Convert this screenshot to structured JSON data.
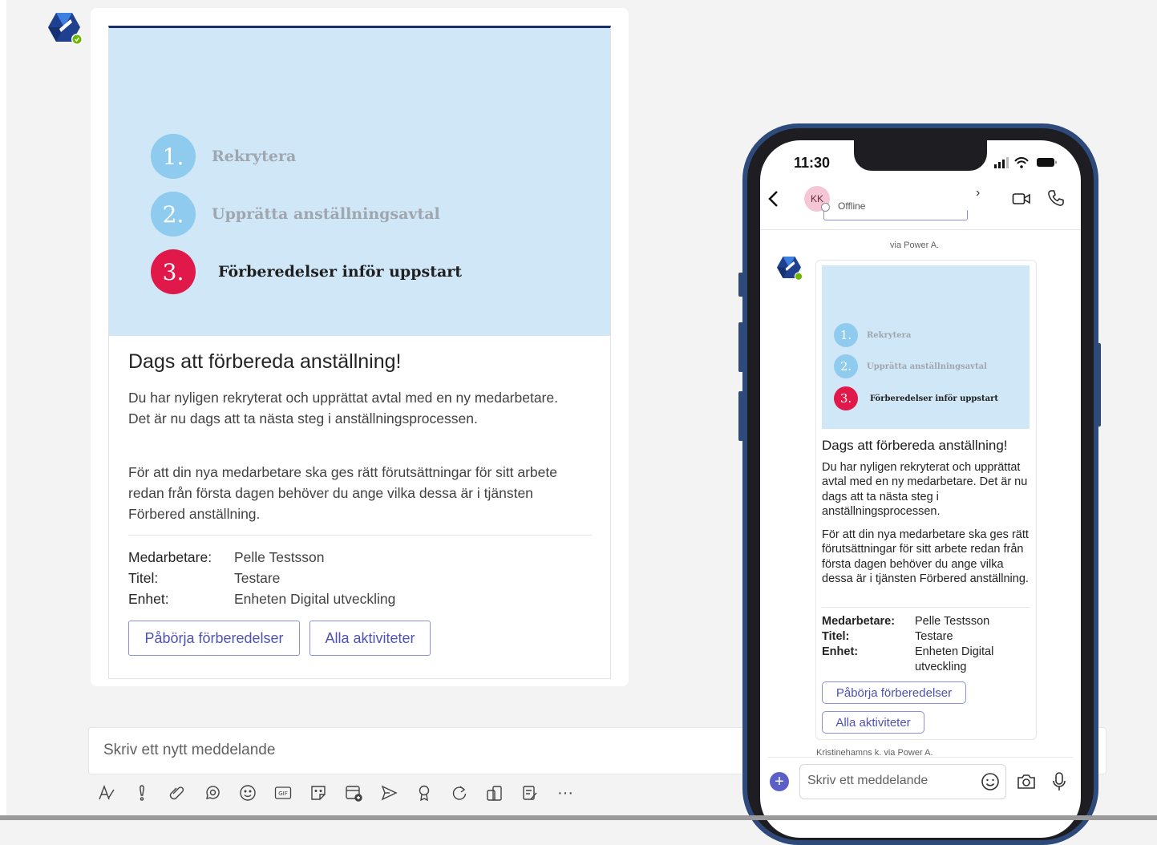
{
  "colors": {
    "accent": "#5b5fc7",
    "hero_bg": "#cfe7f7",
    "step_done": "#8ecbee",
    "step_active": "#e0194a",
    "button_text": "#4f52b2"
  },
  "card": {
    "steps": [
      {
        "number": "1.",
        "label": "Rekrytera",
        "state": "done"
      },
      {
        "number": "2.",
        "label": "Upprätta anställningsavtal",
        "state": "done"
      },
      {
        "number": "3.",
        "label": "Förberedelser inför uppstart",
        "state": "active"
      }
    ],
    "title": "Dags att förbereda anställning!",
    "paragraph1": "Du har nyligen rekryterat och upprättat avtal med en ny medarbetare. Det är nu dags att ta nästa steg i anställningsprocessen.",
    "paragraph2": "För att din nya medarbetare ska ges rätt förutsättningar för sitt arbete redan från första dagen behöver du ange vilka dessa är i tjänsten Förbered anställning.",
    "facts": [
      {
        "key": "Medarbetare:",
        "value": "Pelle Testsson"
      },
      {
        "key": "Titel:",
        "value": "Testare"
      },
      {
        "key": "Enhet:",
        "value": "Enheten Digital utveckling"
      }
    ],
    "buttons": {
      "start": "Påbörja förberedelser",
      "all": "Alla aktiviteter"
    }
  },
  "compose": {
    "placeholder": "Skriv ett nytt meddelande",
    "toolbar_icons": [
      "format-icon",
      "important-icon",
      "attach-icon",
      "loop-icon",
      "emoji-icon",
      "gif-icon",
      "sticker-icon",
      "schedule-meeting-icon",
      "send-icon",
      "praise-icon",
      "refresh-icon",
      "apps-icon",
      "notes-icon",
      "more-icon"
    ],
    "more_label": "···"
  },
  "phone": {
    "time": "11:30",
    "contact_initials": "KK",
    "contact_status": "Offline",
    "chevron": "›",
    "via_top": "via Power A.",
    "via_bottom": "Kristinehamns k. via Power A.",
    "facts_wrapped": {
      "medarbetare_key": "Medarbetare:",
      "medarbetare_value": "Pelle Testsson",
      "titel_key": "Titel:",
      "titel_value": "Testare",
      "enhet_key": "Enhet:",
      "enhet_value": "Enheten Digital utveckling"
    },
    "input_placeholder": "Skriv ett meddelande",
    "plus": "+"
  }
}
